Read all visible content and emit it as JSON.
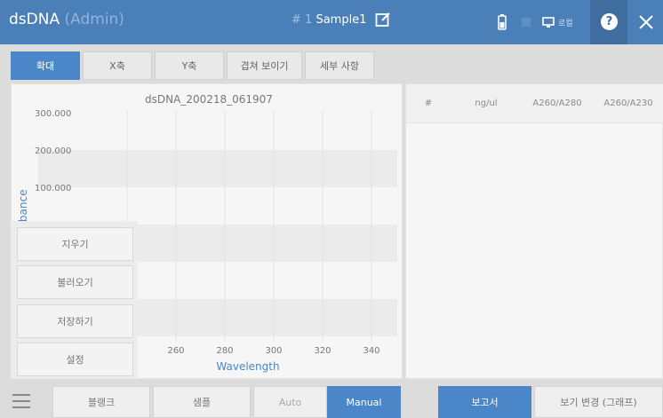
{
  "header": {
    "app_name": "dsDNA",
    "role": "(Admin)",
    "sample_number": "# 1",
    "sample_name": "Sample1",
    "local_label": "로컬"
  },
  "tabs": [
    {
      "label": "확대",
      "active": true
    },
    {
      "label": "X축"
    },
    {
      "label": "Y축"
    },
    {
      "label": "겹쳐 보이기"
    },
    {
      "label": "세부 사항"
    }
  ],
  "chart_data": {
    "type": "line",
    "title": "dsDNA_200218_061907",
    "xlabel": "Wavelength",
    "ylabel": "Absorbance",
    "x_ticks": [
      "260",
      "280",
      "300",
      "320",
      "340"
    ],
    "y_ticks": [
      "300.000",
      "200.000",
      "100.000"
    ],
    "series": []
  },
  "overlay_menu": [
    "지우기",
    "불러오기",
    "저장하기",
    "설정"
  ],
  "table": {
    "columns": [
      "#",
      "ng/ul",
      "A260/A280",
      "A260/A230"
    ],
    "rows": []
  },
  "footer": {
    "blank": "블랭크",
    "sample": "샘플",
    "auto": "Auto",
    "manual": "Manual",
    "report": "보고서",
    "view_change": "보기 변경 (그래프)"
  }
}
